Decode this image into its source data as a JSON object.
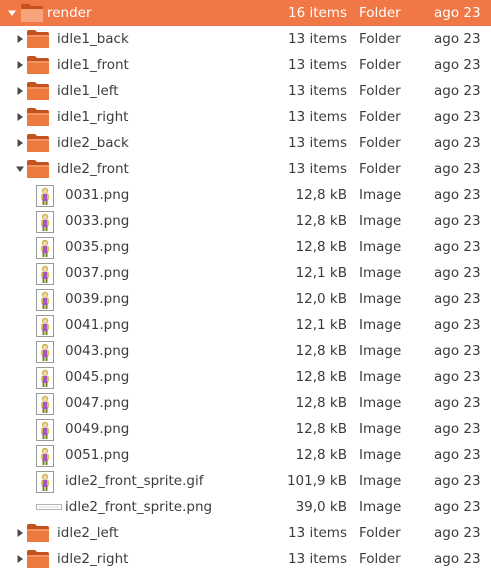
{
  "colors": {
    "selection": "#f07746",
    "folder": "#e8692c",
    "text": "#3c3c3c"
  },
  "rows": [
    {
      "name": "render",
      "size": "16 items",
      "type": "Folder",
      "date": "ago 23",
      "kind": "folder",
      "level": 0,
      "expander": "expanded",
      "selected": true
    },
    {
      "name": "idle1_back",
      "size": "13 items",
      "type": "Folder",
      "date": "ago 23",
      "kind": "folder",
      "level": 1,
      "expander": "collapsed"
    },
    {
      "name": "idle1_front",
      "size": "13 items",
      "type": "Folder",
      "date": "ago 23",
      "kind": "folder",
      "level": 1,
      "expander": "collapsed"
    },
    {
      "name": "idle1_left",
      "size": "13 items",
      "type": "Folder",
      "date": "ago 23",
      "kind": "folder",
      "level": 1,
      "expander": "collapsed"
    },
    {
      "name": "idle1_right",
      "size": "13 items",
      "type": "Folder",
      "date": "ago 23",
      "kind": "folder",
      "level": 1,
      "expander": "collapsed"
    },
    {
      "name": "idle2_back",
      "size": "13 items",
      "type": "Folder",
      "date": "ago 23",
      "kind": "folder",
      "level": 1,
      "expander": "collapsed"
    },
    {
      "name": "idle2_front",
      "size": "13 items",
      "type": "Folder",
      "date": "ago 23",
      "kind": "folder",
      "level": 1,
      "expander": "expanded"
    },
    {
      "name": "0031.png",
      "size": "12,8 kB",
      "type": "Image",
      "date": "ago 23",
      "kind": "image",
      "level": 2
    },
    {
      "name": "0033.png",
      "size": "12,8 kB",
      "type": "Image",
      "date": "ago 23",
      "kind": "image",
      "level": 2
    },
    {
      "name": "0035.png",
      "size": "12,8 kB",
      "type": "Image",
      "date": "ago 23",
      "kind": "image",
      "level": 2
    },
    {
      "name": "0037.png",
      "size": "12,1 kB",
      "type": "Image",
      "date": "ago 23",
      "kind": "image",
      "level": 2
    },
    {
      "name": "0039.png",
      "size": "12,0 kB",
      "type": "Image",
      "date": "ago 23",
      "kind": "image",
      "level": 2
    },
    {
      "name": "0041.png",
      "size": "12,1 kB",
      "type": "Image",
      "date": "ago 23",
      "kind": "image",
      "level": 2
    },
    {
      "name": "0043.png",
      "size": "12,8 kB",
      "type": "Image",
      "date": "ago 23",
      "kind": "image",
      "level": 2
    },
    {
      "name": "0045.png",
      "size": "12,8 kB",
      "type": "Image",
      "date": "ago 23",
      "kind": "image",
      "level": 2
    },
    {
      "name": "0047.png",
      "size": "12,8 kB",
      "type": "Image",
      "date": "ago 23",
      "kind": "image",
      "level": 2
    },
    {
      "name": "0049.png",
      "size": "12,8 kB",
      "type": "Image",
      "date": "ago 23",
      "kind": "image",
      "level": 2
    },
    {
      "name": "0051.png",
      "size": "12,8 kB",
      "type": "Image",
      "date": "ago 23",
      "kind": "image",
      "level": 2
    },
    {
      "name": "idle2_front_sprite.gif",
      "size": "101,9 kB",
      "type": "Image",
      "date": "ago 23",
      "kind": "image",
      "level": 2
    },
    {
      "name": "idle2_front_sprite.png",
      "size": "39,0 kB",
      "type": "Image",
      "date": "ago 23",
      "kind": "sprite-strip",
      "level": 2
    },
    {
      "name": "idle2_left",
      "size": "13 items",
      "type": "Folder",
      "date": "ago 23",
      "kind": "folder",
      "level": 1,
      "expander": "collapsed"
    },
    {
      "name": "idle2_right",
      "size": "13 items",
      "type": "Folder",
      "date": "ago 23",
      "kind": "folder",
      "level": 1,
      "expander": "collapsed"
    }
  ]
}
